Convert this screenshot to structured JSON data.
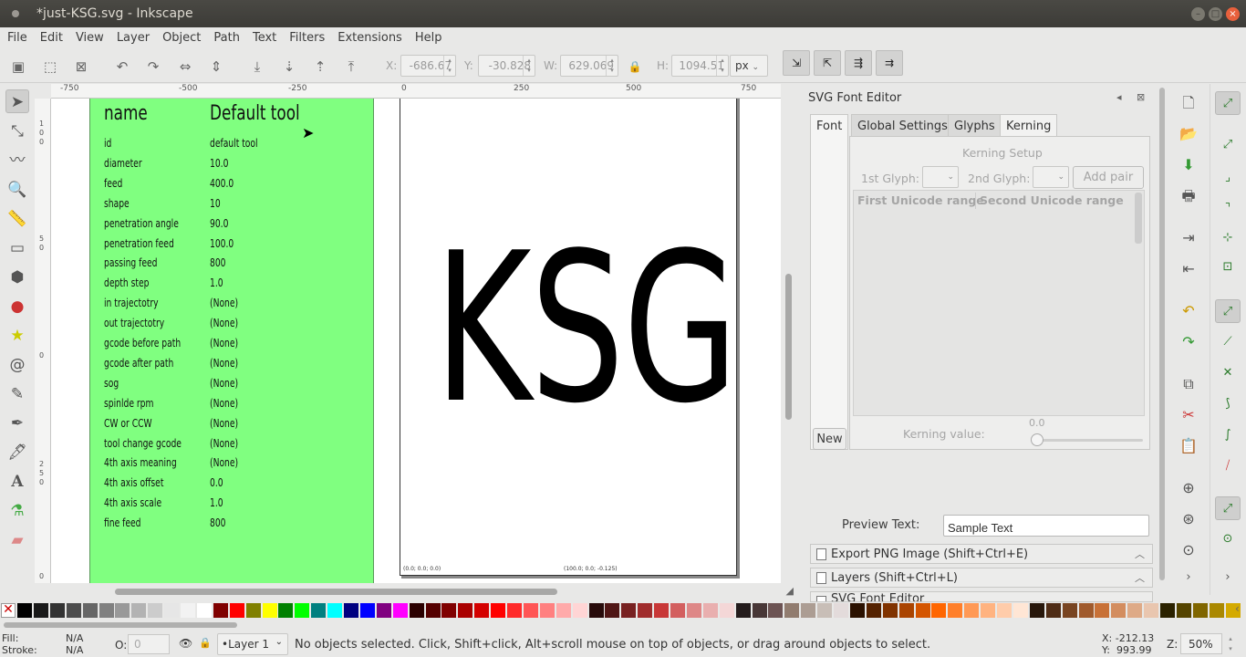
{
  "window": {
    "title": "*just-KSG.svg - Inkscape"
  },
  "menu": [
    "File",
    "Edit",
    "View",
    "Layer",
    "Object",
    "Path",
    "Text",
    "Filters",
    "Extensions",
    "Help"
  ],
  "toolbar": {
    "x_label": "X:",
    "x_value": "-686.67",
    "y_label": "Y:",
    "y_value": "-30.828",
    "w_label": "W:",
    "w_value": "629.069",
    "h_label": "H:",
    "h_value": "1094.51",
    "unit": "px"
  },
  "ruler": {
    "h_ticks": [
      "-750",
      "-500",
      "-250",
      "0",
      "250",
      "500",
      "750"
    ],
    "v_ticks": [
      "1",
      "0",
      "0",
      "5",
      "0",
      "0",
      "2",
      "5",
      "0",
      "0"
    ]
  },
  "table": {
    "head_name": "name",
    "head_value": "Default tool",
    "rows": [
      {
        "k": "id",
        "v": "default tool"
      },
      {
        "k": "diameter",
        "v": "10.0"
      },
      {
        "k": "feed",
        "v": "400.0"
      },
      {
        "k": "shape",
        "v": "10"
      },
      {
        "k": "penetration angle",
        "v": "90.0"
      },
      {
        "k": "penetration feed",
        "v": "100.0"
      },
      {
        "k": "passing feed",
        "v": "800"
      },
      {
        "k": "depth step",
        "v": "1.0"
      },
      {
        "k": "in trajectotry",
        "v": "(None)"
      },
      {
        "k": "out trajectotry",
        "v": "(None)"
      },
      {
        "k": "gcode before path",
        "v": "(None)"
      },
      {
        "k": "gcode after path",
        "v": "(None)"
      },
      {
        "k": "sog",
        "v": "(None)"
      },
      {
        "k": "spinlde rpm",
        "v": "(None)"
      },
      {
        "k": "CW or CCW",
        "v": "(None)"
      },
      {
        "k": "tool change gcode",
        "v": "(None)"
      },
      {
        "k": "4th axis meaning",
        "v": "(None)"
      },
      {
        "k": "4th axis offset",
        "v": "0.0"
      },
      {
        "k": "4th axis scale",
        "v": "1.0"
      },
      {
        "k": "fine feed",
        "v": "800"
      }
    ]
  },
  "drawing": {
    "text": "KSG",
    "coord1": "(0.0; 0.0; 0.0)",
    "coord2": "(100.0; 0.0; -0.125)"
  },
  "dock": {
    "title": "SVG Font Editor",
    "tabs": [
      "Font",
      "Global Settings",
      "Glyphs",
      "Kerning"
    ],
    "kerning_setup": "Kerning Setup",
    "first_glyph": "1st Glyph:",
    "second_glyph": "2nd Glyph:",
    "add_pair": "Add pair",
    "col1": "First Unicode range",
    "col2": "Second Unicode range",
    "new_btn": "New",
    "kerning_value_label": "Kerning value:",
    "kerning_value": "0.0",
    "preview_label": "Preview Text:",
    "preview_text": "Sample Text",
    "export_png": "Export PNG Image (Shift+Ctrl+E)",
    "layers": "Layers (Shift+Ctrl+L)",
    "svg_font_editor": "SVG Font Editor"
  },
  "palette_colors": [
    "#000000",
    "#1a1a1a",
    "#333333",
    "#4d4d4d",
    "#666666",
    "#808080",
    "#999999",
    "#b3b3b3",
    "#cccccc",
    "#e6e6e6",
    "#f2f2f2",
    "#ffffff",
    "#800000",
    "#ff0000",
    "#808000",
    "#ffff00",
    "#008000",
    "#00ff00",
    "#008080",
    "#00ffff",
    "#000080",
    "#0000ff",
    "#800080",
    "#ff00ff",
    "#2b0000",
    "#550000",
    "#800000",
    "#aa0000",
    "#d40000",
    "#ff0000",
    "#ff2a2a",
    "#ff5555",
    "#ff8080",
    "#ffaaaa",
    "#ffd5d5",
    "#280b0b",
    "#501616",
    "#782121",
    "#a02c2c",
    "#c83737",
    "#d35f5f",
    "#de8787",
    "#e9afaf",
    "#f4d7d7",
    "#241c1c",
    "#483737",
    "#6c5353",
    "#917c6f",
    "#ac9d93",
    "#c8beb7",
    "#e3dbdb",
    "#2b1100",
    "#552200",
    "#803300",
    "#aa4400",
    "#d45500",
    "#ff6600",
    "#ff7f2a",
    "#ff9955",
    "#ffb380",
    "#ffccaa",
    "#ffe6d5",
    "#28170b",
    "#502d16",
    "#784421",
    "#a05a2c",
    "#c87137",
    "#d38d5f",
    "#deaa87",
    "#e9c6af",
    "#2b2200",
    "#554400",
    "#806600",
    "#aa8800",
    "#d4aa00"
  ],
  "status": {
    "fill_label": "Fill:",
    "fill_value": "N/A",
    "stroke_label": "Stroke:",
    "stroke_value": "N/A",
    "opacity_label": "O:",
    "opacity_value": "0",
    "layer": "•Layer 1",
    "message": "No objects selected. Click, Shift+click, Alt+scroll mouse on top of objects, or drag around objects to select.",
    "x_coord": "X: -212.13",
    "y_coord": "Y:  993.99",
    "zoom_label": "Z:",
    "zoom": "50%"
  }
}
